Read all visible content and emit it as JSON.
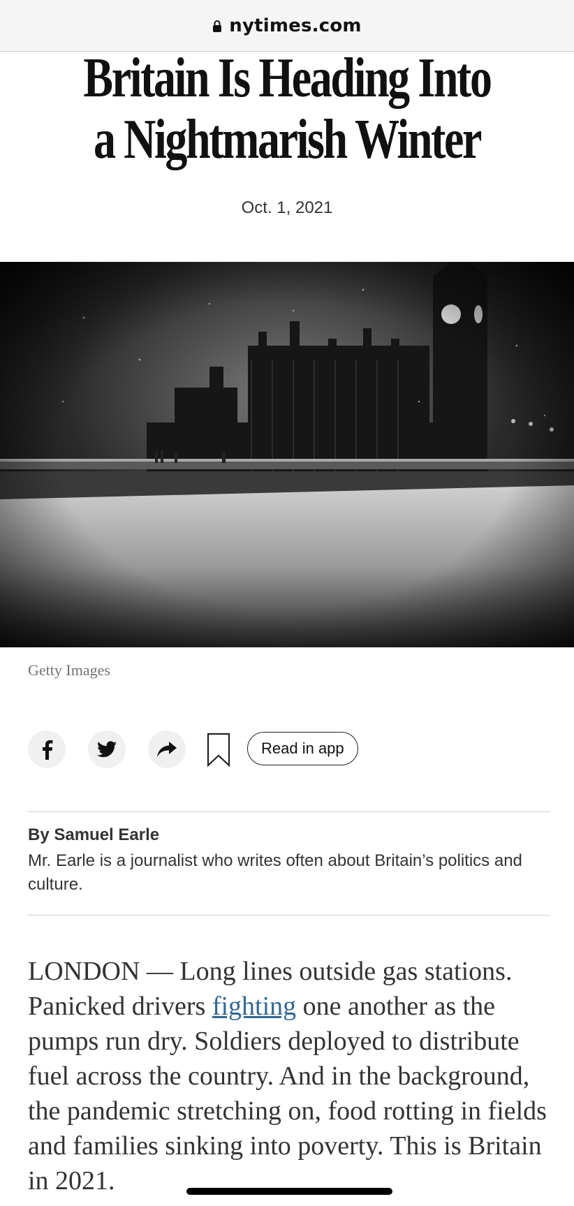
{
  "browser": {
    "domain": "nytimes.com",
    "lock_icon": "lock-icon"
  },
  "article": {
    "headline": "Britain Is Heading Into a Nightmarish Winter",
    "date": "Oct. 1, 2021",
    "image_credit": "Getty Images",
    "actions": {
      "icons": [
        "facebook-icon",
        "twitter-icon",
        "share-arrow-icon",
        "bookmark-icon"
      ],
      "read_in_app": "Read in app"
    },
    "byline": "By Samuel Earle",
    "author_bio": "Mr. Earle is a journalist who writes often about Britain’s politics and culture.",
    "body": {
      "before_link": "LONDON — Long lines outside gas stations. Panicked drivers ",
      "link_text": "fighting",
      "after_link": " one another as the pumps run dry. Soldiers deployed to distribute fuel across the country. And in the background, the pandemic stretching on, food rotting in fields and families sinking into poverty. This is Britain in 2021."
    }
  },
  "colors": {
    "link": "#326891",
    "text": "#333333",
    "headline": "#111111"
  }
}
